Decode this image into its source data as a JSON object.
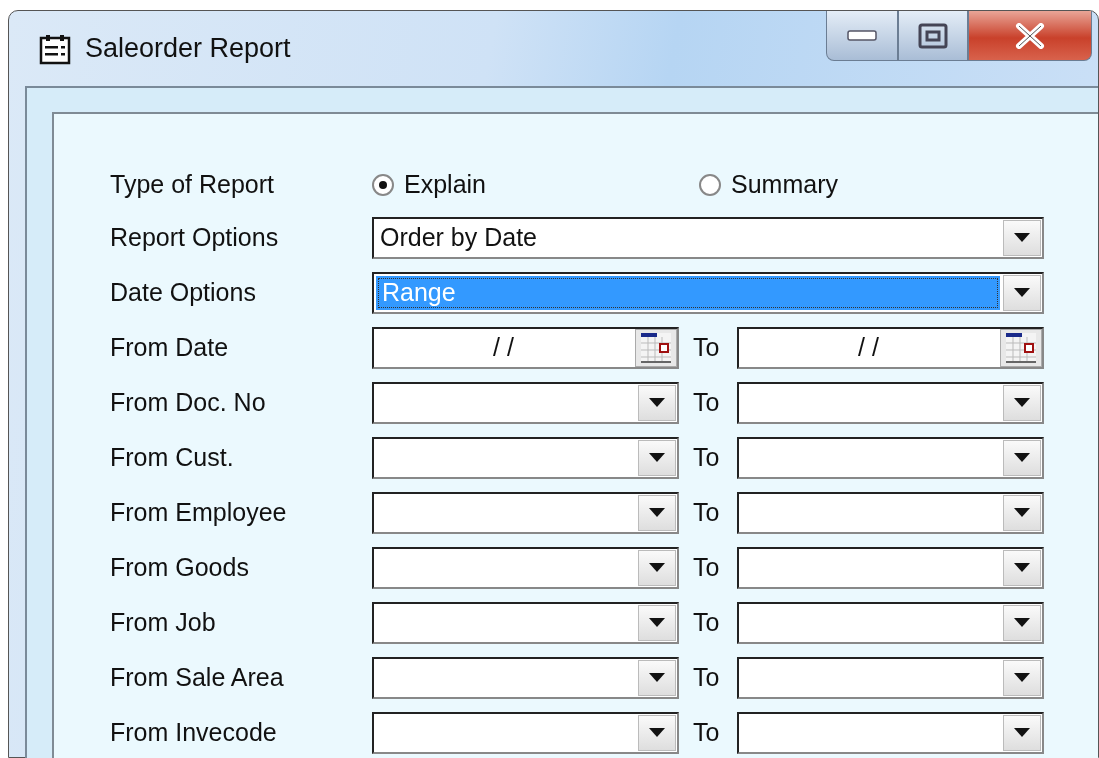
{
  "window": {
    "title": "Saleorder Report"
  },
  "report_type": {
    "label": "Type of Report",
    "options": [
      {
        "label": "Explain",
        "selected": true
      },
      {
        "label": "Summary",
        "selected": false
      }
    ]
  },
  "report_options": {
    "label": "Report Options",
    "value": "Order by Date",
    "selected": false
  },
  "date_options": {
    "label": "Date Options",
    "value": "Range",
    "selected": true
  },
  "date_range": {
    "label": "From Date",
    "from": "/ /",
    "to_label": "To",
    "to": "/ /"
  },
  "ranges": [
    {
      "label": "From Doc. No",
      "to_label": "To"
    },
    {
      "label": "From Cust.",
      "to_label": "To"
    },
    {
      "label": "From Employee",
      "to_label": "To"
    },
    {
      "label": "From Goods",
      "to_label": "To"
    },
    {
      "label": "From Job",
      "to_label": "To"
    },
    {
      "label": "From Sale Area",
      "to_label": "To"
    },
    {
      "label": "From Invecode",
      "to_label": "To"
    }
  ]
}
